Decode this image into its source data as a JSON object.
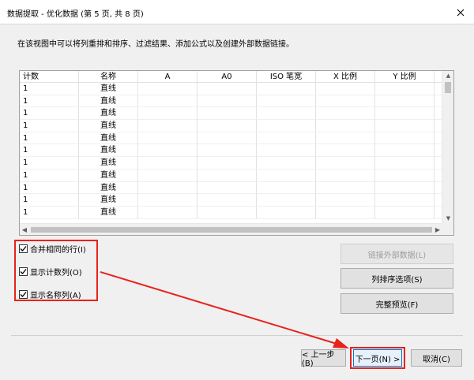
{
  "window": {
    "title": "数据提取 - 优化数据 (第 5 页, 共 8 页)",
    "close_glyph": "✕"
  },
  "instruction": "在该视图中可以将列重排和排序、过滤结果、添加公式以及创建外部数据链接。",
  "table": {
    "columns": [
      "计数",
      "名称",
      "A",
      "A0",
      "ISO 笔宽",
      "X 比例",
      "Y 比例"
    ],
    "rows": [
      [
        "1",
        "直线"
      ],
      [
        "1",
        "直线"
      ],
      [
        "1",
        "直线"
      ],
      [
        "1",
        "直线"
      ],
      [
        "1",
        "直线"
      ],
      [
        "1",
        "直线"
      ],
      [
        "1",
        "直线"
      ],
      [
        "1",
        "直线"
      ],
      [
        "1",
        "直线"
      ],
      [
        "1",
        "直线"
      ],
      [
        "1",
        "直线"
      ]
    ]
  },
  "options": {
    "merge_rows": "合并相同的行(I)",
    "show_count": "显示计数列(O)",
    "show_name": "显示名称列(A)"
  },
  "right_buttons": {
    "link_external": "链接外部数据(L)",
    "column_sort": "列排序选项(S)",
    "full_preview": "完整预览(F)"
  },
  "nav": {
    "back": "< 上一步(B)",
    "next": "下一页(N) >",
    "cancel": "取消(C)"
  },
  "colors": {
    "highlight": "#e8221b",
    "accent": "#0078d7"
  }
}
